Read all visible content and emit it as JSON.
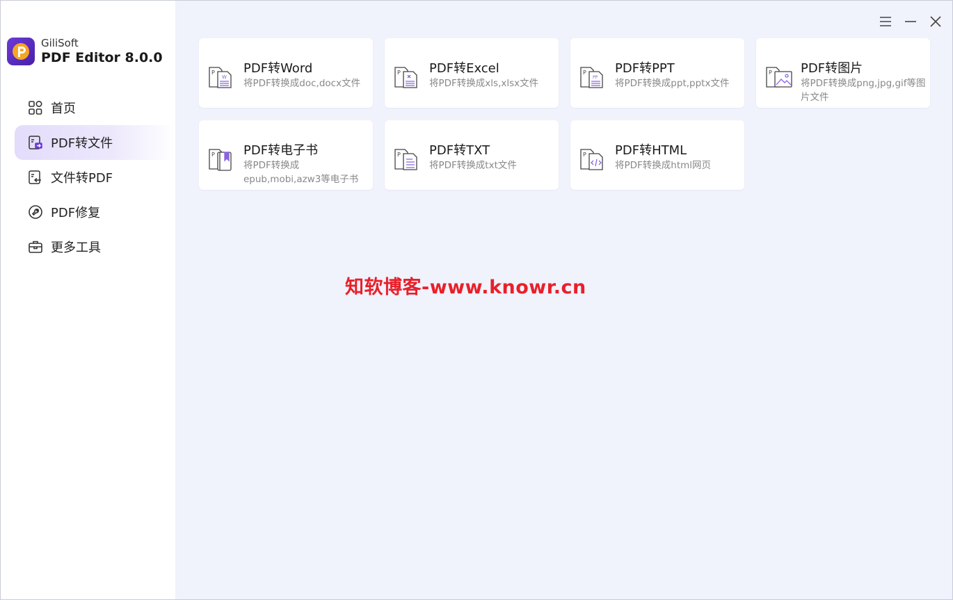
{
  "app": {
    "company": "GiliSoft",
    "product": "PDF Editor 8.0.0"
  },
  "colors": {
    "accent": "#6a3bd8",
    "active_nav": "#e6e0fb",
    "background": "#f0f2fc",
    "watermark": "#e8202a"
  },
  "sidebar": {
    "items": [
      {
        "label": "首页",
        "icon": "grid-icon"
      },
      {
        "label": "PDF转文件",
        "icon": "pdf-to-file-icon",
        "active": true
      },
      {
        "label": "文件转PDF",
        "icon": "file-to-pdf-icon"
      },
      {
        "label": "PDF修复",
        "icon": "repair-icon"
      },
      {
        "label": "更多工具",
        "icon": "toolbox-icon"
      }
    ]
  },
  "cards": [
    {
      "title": "PDF转Word",
      "desc": "将PDF转换成doc,docx文件",
      "icon": "word-doc-icon"
    },
    {
      "title": "PDF转Excel",
      "desc": "将PDF转换成xls,xlsx文件",
      "icon": "excel-doc-icon"
    },
    {
      "title": "PDF转PPT",
      "desc": "将PDF转换成ppt,pptx文件",
      "icon": "ppt-doc-icon"
    },
    {
      "title": "PDF转图片",
      "desc": "将PDF转换成png,jpg,gif等图片文件",
      "icon": "image-doc-icon"
    },
    {
      "title": "PDF转电子书",
      "desc": "将PDF转换成 epub,mobi,azw3等电子书",
      "icon": "ebook-doc-icon"
    },
    {
      "title": "PDF转TXT",
      "desc": "将PDF转换成txt文件",
      "icon": "txt-doc-icon"
    },
    {
      "title": "PDF转HTML",
      "desc": "将PDF转换成html网页",
      "icon": "html-doc-icon"
    }
  ],
  "watermark": "知软博客-www.knowr.cn"
}
